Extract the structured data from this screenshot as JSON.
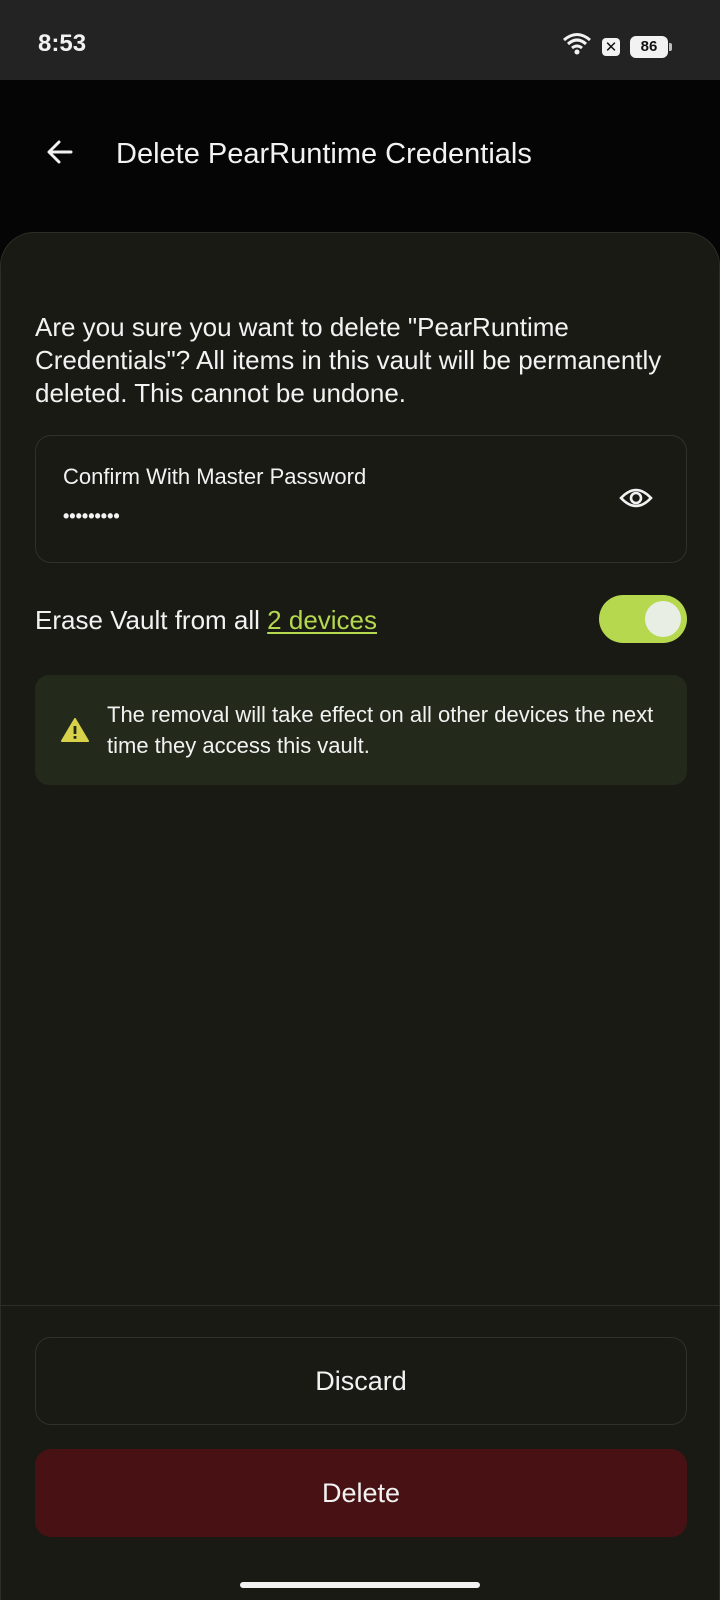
{
  "status_bar": {
    "time": "8:53",
    "battery": "86",
    "notification_badge": "✕"
  },
  "appbar": {
    "title": "Delete PearRuntime Credentials",
    "back_icon": "arrow-left-icon"
  },
  "dialog": {
    "message": "Are you sure you want to delete \"PearRuntime Credentials\"? All items in this vault will be permanently deleted. This cannot be undone.",
    "password_field": {
      "label": "Confirm With Master Password",
      "value": "•••••••••",
      "toggle_icon": "eye-icon"
    },
    "erase_option": {
      "label": "Erase Vault from all ",
      "link": "2 devices",
      "enabled": true
    },
    "info": {
      "icon": "warning-icon",
      "text": "The removal will take effect on all other devices the next time they access this vault."
    },
    "buttons": {
      "discard": "Discard",
      "delete": "Delete"
    }
  },
  "colors": {
    "accent": "#b5d84e",
    "sheet_bg": "#181a13",
    "info_bg": "#242a1b",
    "danger_bg": "#481214",
    "warning": "#d7d24a"
  }
}
